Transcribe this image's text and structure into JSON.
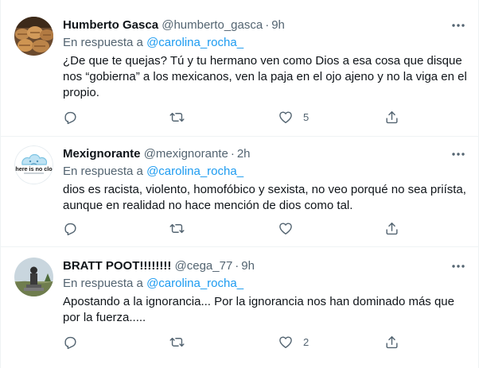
{
  "reply_prefix": "En respuesta a",
  "tweets": [
    {
      "display_name": "Humberto Gasca",
      "handle": "@humberto_gasca",
      "separator": "·",
      "time": "9h",
      "reply_to": "@carolina_rocha_",
      "text_lines": [
        "¿De que te quejas? Tú y tu hermano ven como Dios a esa cosa que disque",
        "nos “gobierna” a los mexicanos, ven la paja en el ojo ajeno y no la viga en el",
        "propio."
      ],
      "reply_count": "",
      "retweet_count": "",
      "like_count": "5"
    },
    {
      "display_name": "Mexignorante",
      "handle": "@mexignorante",
      "separator": "·",
      "time": "2h",
      "reply_to": "@carolina_rocha_",
      "text_lines": [
        "dios es racista, violento, homofóbico y sexista, no veo porqué no sea priísta,",
        "aunque en realidad no hace mención de dios como tal."
      ],
      "reply_count": "",
      "retweet_count": "",
      "like_count": ""
    },
    {
      "display_name": "BRATT POOT!!!!!!!!",
      "handle": "@cega_77",
      "separator": "·",
      "time": "9h",
      "reply_to": "@carolina_rocha_",
      "text_lines": [
        "Apostando a la ignorancia... Por la ignorancia nos han dominado más que",
        "por la fuerza....."
      ],
      "reply_count": "",
      "retweet_count": "",
      "like_count": "2"
    }
  ],
  "avatar_2_logo_text": "here is no clo",
  "colors": {
    "text": "#0f1419",
    "secondary": "#536471",
    "link": "#1d9bf0",
    "divider": "#eff3f4"
  },
  "icons": [
    "reply-icon",
    "retweet-icon",
    "like-icon",
    "share-icon",
    "more-icon"
  ]
}
